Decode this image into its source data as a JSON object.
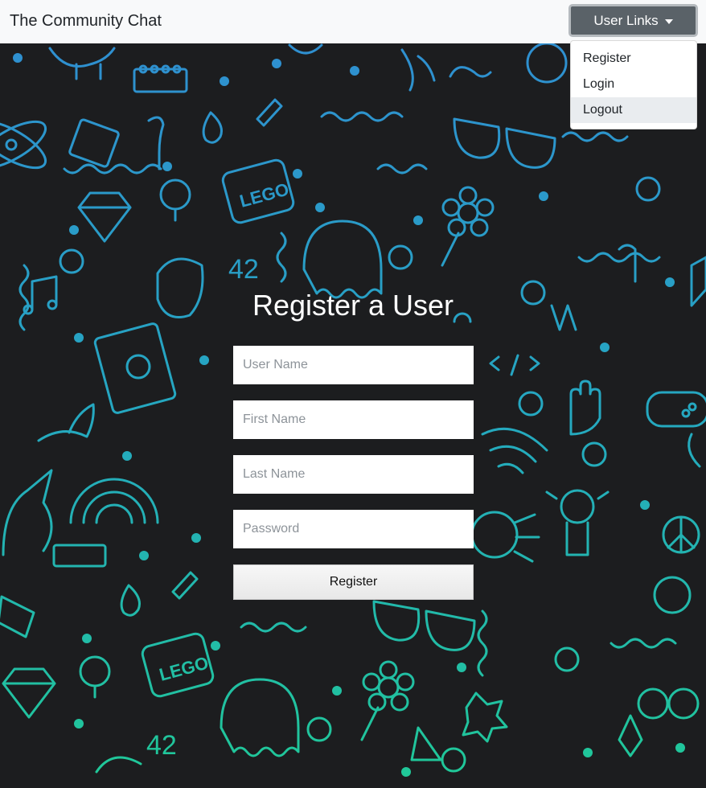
{
  "navbar": {
    "brand": "The Community Chat",
    "user_links_label": "User Links"
  },
  "dropdown": {
    "items": [
      "Register",
      "Login",
      "Logout"
    ],
    "highlighted_item": "Logout"
  },
  "background": {
    "lego_text": "LEGO",
    "number_text": "42"
  },
  "form": {
    "title": "Register a User",
    "username_placeholder": "User Name",
    "firstname_placeholder": "First Name",
    "lastname_placeholder": "Last Name",
    "password_placeholder": "Password",
    "submit_label": "Register"
  },
  "colors": {
    "navbar_bg": "#f8f9fa",
    "page_bg": "#1c1d1f",
    "doodle_top": "#2f8fd0",
    "doodle_bottom": "#20c997",
    "button_bg": "#5a6268"
  },
  "icons": [
    "caret-down-icon",
    "doodle-background"
  ]
}
